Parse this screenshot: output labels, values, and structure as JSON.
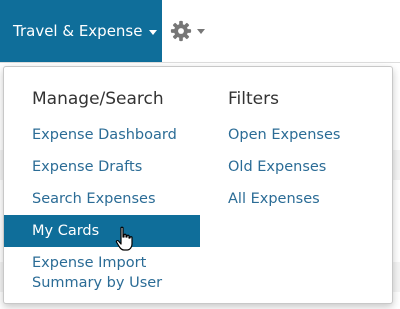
{
  "nav": {
    "module_label": "Travel & Expense"
  },
  "dropdown": {
    "left_column": {
      "heading": "Manage/Search",
      "items": [
        {
          "label": "Expense Dashboard"
        },
        {
          "label": "Expense Drafts"
        },
        {
          "label": "Search Expenses"
        },
        {
          "label": "My Cards"
        },
        {
          "label_line1": "Expense Import",
          "label_line2": "Summary by User"
        }
      ],
      "selected_item": "My Cards"
    },
    "right_column": {
      "heading": "Filters",
      "items": [
        {
          "label": "Open Expenses"
        },
        {
          "label": "Old Expenses"
        },
        {
          "label": "All Expenses"
        }
      ]
    }
  },
  "colors": {
    "accent": "#0f6e9a",
    "link": "#2b6c96",
    "heading": "#333333",
    "gear": "#777777"
  },
  "icons": {
    "settings": "gear-icon",
    "module_dropdown": "caret-down-icon",
    "settings_dropdown": "caret-down-icon",
    "pointer": "hand-pointer-cursor-icon"
  }
}
